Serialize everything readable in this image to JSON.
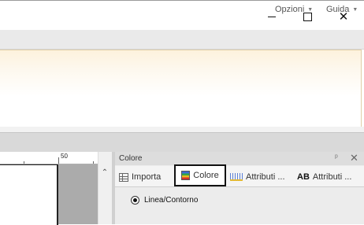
{
  "window": {
    "controls": {
      "minimize": "minimize-icon",
      "maximize": "maximize-icon",
      "close": "close-icon",
      "close_glyph": "✕"
    }
  },
  "menu": {
    "items": [
      {
        "label": "Opzioni",
        "caret": "▼"
      },
      {
        "label": "Guida",
        "caret": "▼"
      }
    ]
  },
  "ruler": {
    "label": "50"
  },
  "scroll": {
    "up_glyph": "⌃"
  },
  "panel": {
    "title": "Colore",
    "pin_glyph": "ᵖ",
    "close_glyph": "✕",
    "tabs": [
      {
        "label": "Importa",
        "icon": "import-icon"
      },
      {
        "label": "Colore",
        "icon": "color-palette-icon",
        "selected": true
      },
      {
        "label": "Attributi ...",
        "icon": "thread-attributes-icon"
      },
      {
        "label": "Attributi ...",
        "icon": "text-attributes-icon",
        "icon_text": "AB"
      }
    ],
    "option": {
      "label": "Linea/Contorno",
      "checked": true
    }
  },
  "colors": {
    "ribbon_top": "#fdf2dd",
    "selected_tab_border": "#111111",
    "panel_bg": "#ececec"
  }
}
